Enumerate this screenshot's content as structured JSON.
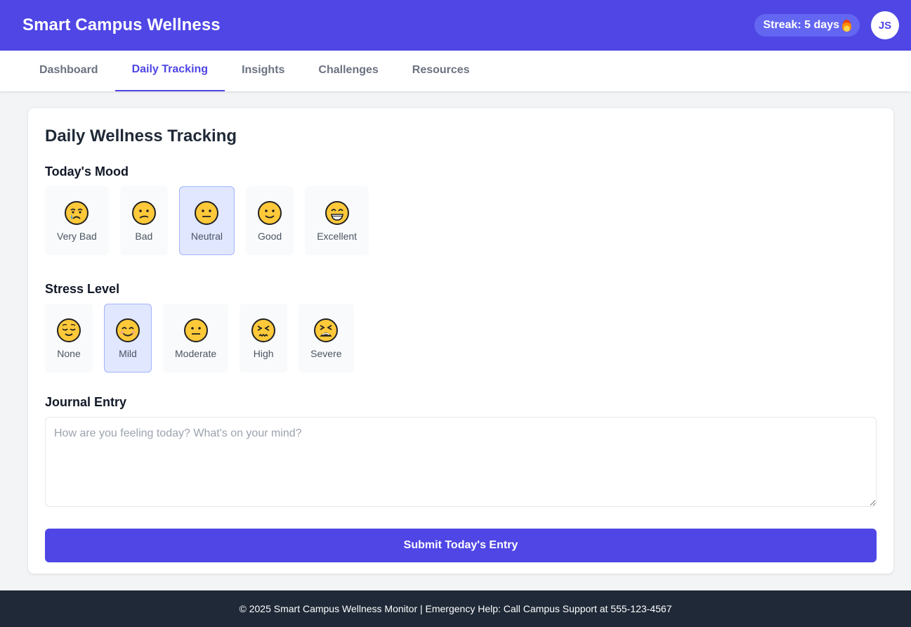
{
  "header": {
    "title": "Smart Campus Wellness",
    "streak": "Streak: 5 days",
    "avatar_initials": "JS",
    "accent_color": "#4f46e5"
  },
  "nav": {
    "tabs": [
      {
        "label": "Dashboard",
        "active": false
      },
      {
        "label": "Daily Tracking",
        "active": true
      },
      {
        "label": "Insights",
        "active": false
      },
      {
        "label": "Challenges",
        "active": false
      },
      {
        "label": "Resources",
        "active": false
      }
    ]
  },
  "main": {
    "title": "Daily Wellness Tracking",
    "mood": {
      "label": "Today's Mood",
      "selected": "Neutral",
      "options": [
        {
          "label": "Very Bad",
          "icon": "crying-face-icon"
        },
        {
          "label": "Bad",
          "icon": "confused-face-icon"
        },
        {
          "label": "Neutral",
          "icon": "neutral-face-icon"
        },
        {
          "label": "Good",
          "icon": "slightly-smiling-face-icon"
        },
        {
          "label": "Excellent",
          "icon": "grinning-face-icon"
        }
      ]
    },
    "stress": {
      "label": "Stress Level",
      "selected": "Mild",
      "options": [
        {
          "label": "None",
          "icon": "relieved-face-icon"
        },
        {
          "label": "Mild",
          "icon": "smiling-face-icon"
        },
        {
          "label": "Moderate",
          "icon": "neutral-face-icon"
        },
        {
          "label": "High",
          "icon": "persevering-face-icon"
        },
        {
          "label": "Severe",
          "icon": "tired-face-icon"
        }
      ]
    },
    "journal": {
      "label": "Journal Entry",
      "placeholder": "How are you feeling today? What's on your mind?",
      "value": ""
    },
    "submit_label": "Submit Today's Entry"
  },
  "footer": {
    "text": "© 2025 Smart Campus Wellness Monitor | Emergency Help: Call Campus Support at 555-123-4567"
  }
}
